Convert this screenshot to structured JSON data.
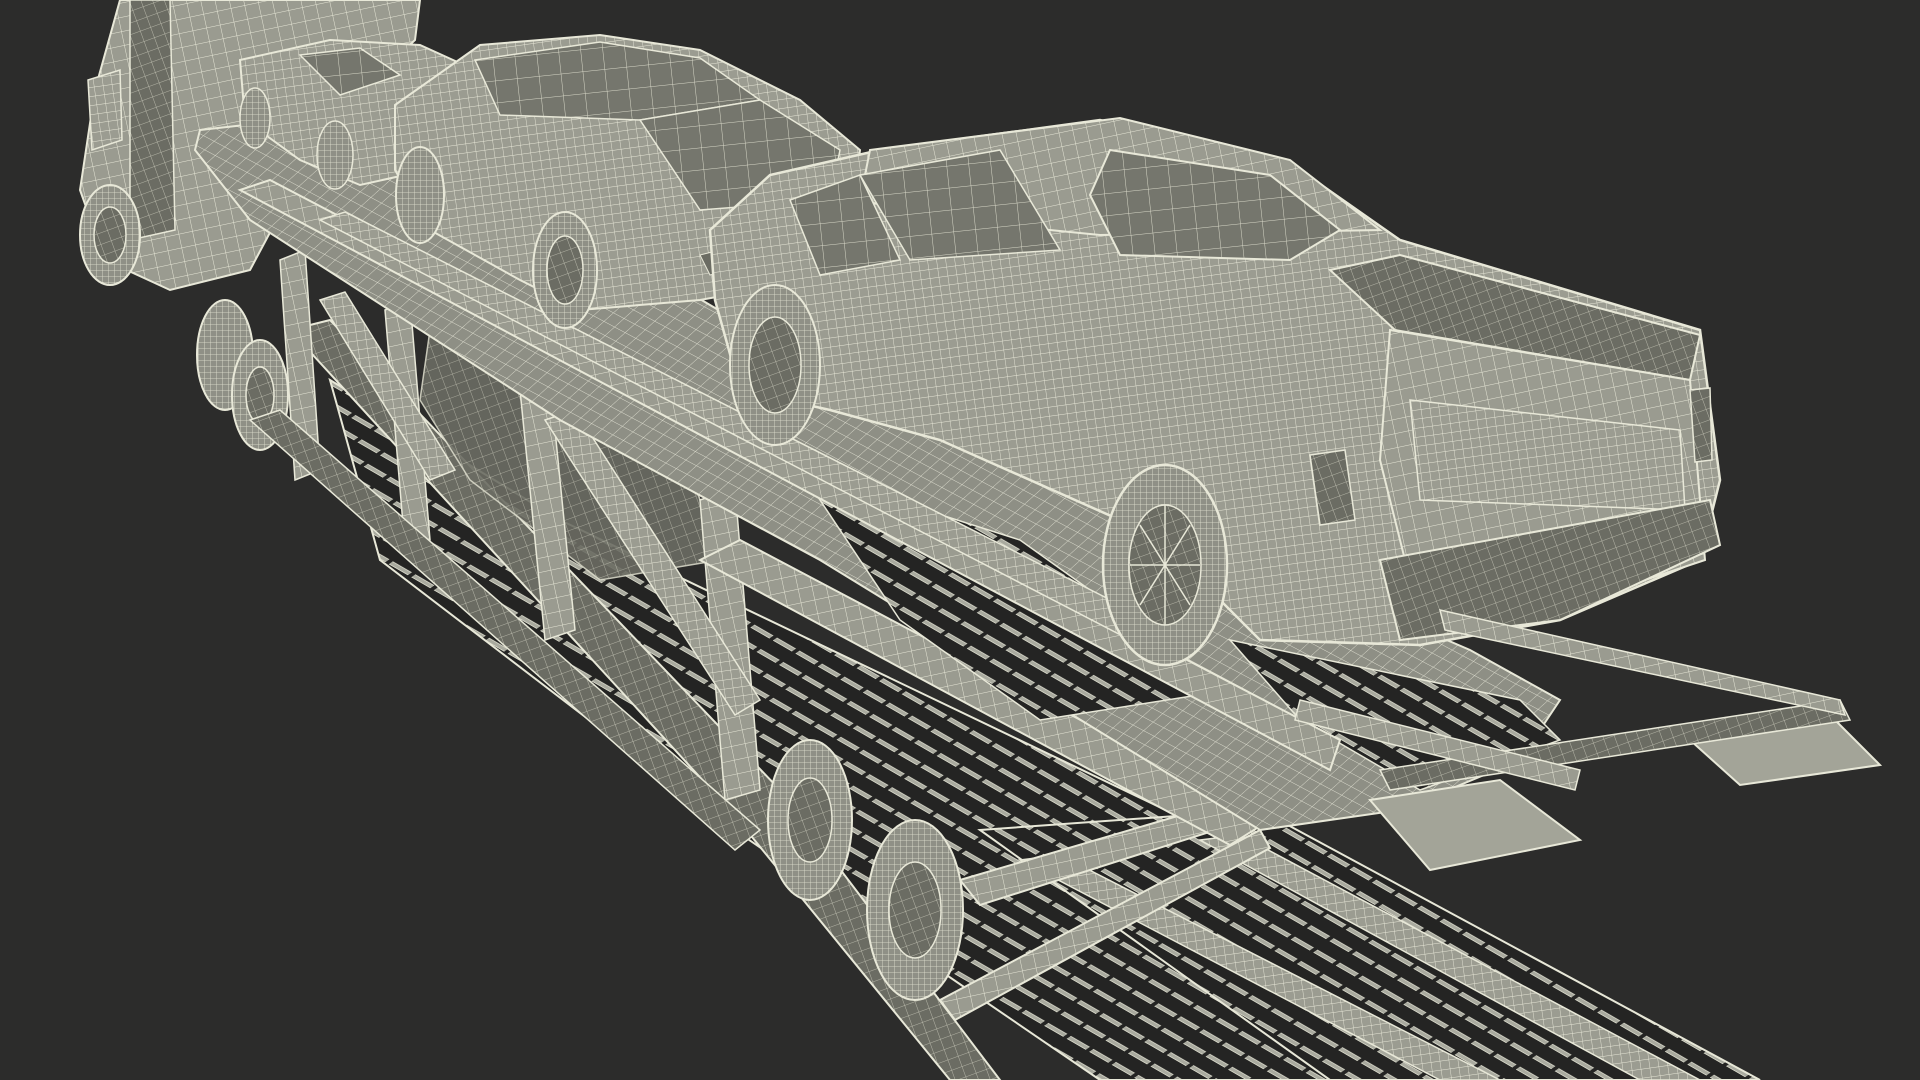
{
  "scene": {
    "subject": "car-carrier-trailer-wireframe",
    "colors": {
      "background": "#2c2c2b",
      "surface": "#9b9c91",
      "surface_dark": "#5e5f57",
      "surface_light": "#b8b8ad",
      "wire": "#e8e8d8",
      "wire_dim": "#cfd0c0",
      "hole": "#242423"
    },
    "objects": [
      "truck-cab",
      "sports-car",
      "suv",
      "pickup-truck",
      "trailer-upper-deck",
      "trailer-lower-deck",
      "loading-ramps",
      "trailer-wheels"
    ]
  }
}
